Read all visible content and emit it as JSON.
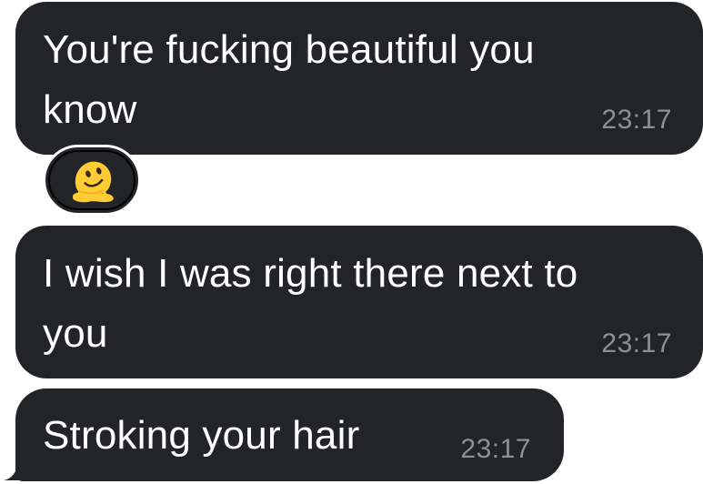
{
  "conversation": {
    "messages": [
      {
        "text": "You're fucking beautiful you\nknow",
        "time": "23:17"
      },
      {
        "text": "I wish I was right there next to\nyou",
        "time": "23:17"
      },
      {
        "text": "Stroking your hair",
        "time": "23:17"
      }
    ],
    "reaction": {
      "icon": "melting-face-emoji-icon"
    }
  },
  "colors": {
    "bubble": "#222427",
    "text": "#ffffff",
    "timestamp": "#8e9094",
    "emoji": "#ffcc33"
  }
}
